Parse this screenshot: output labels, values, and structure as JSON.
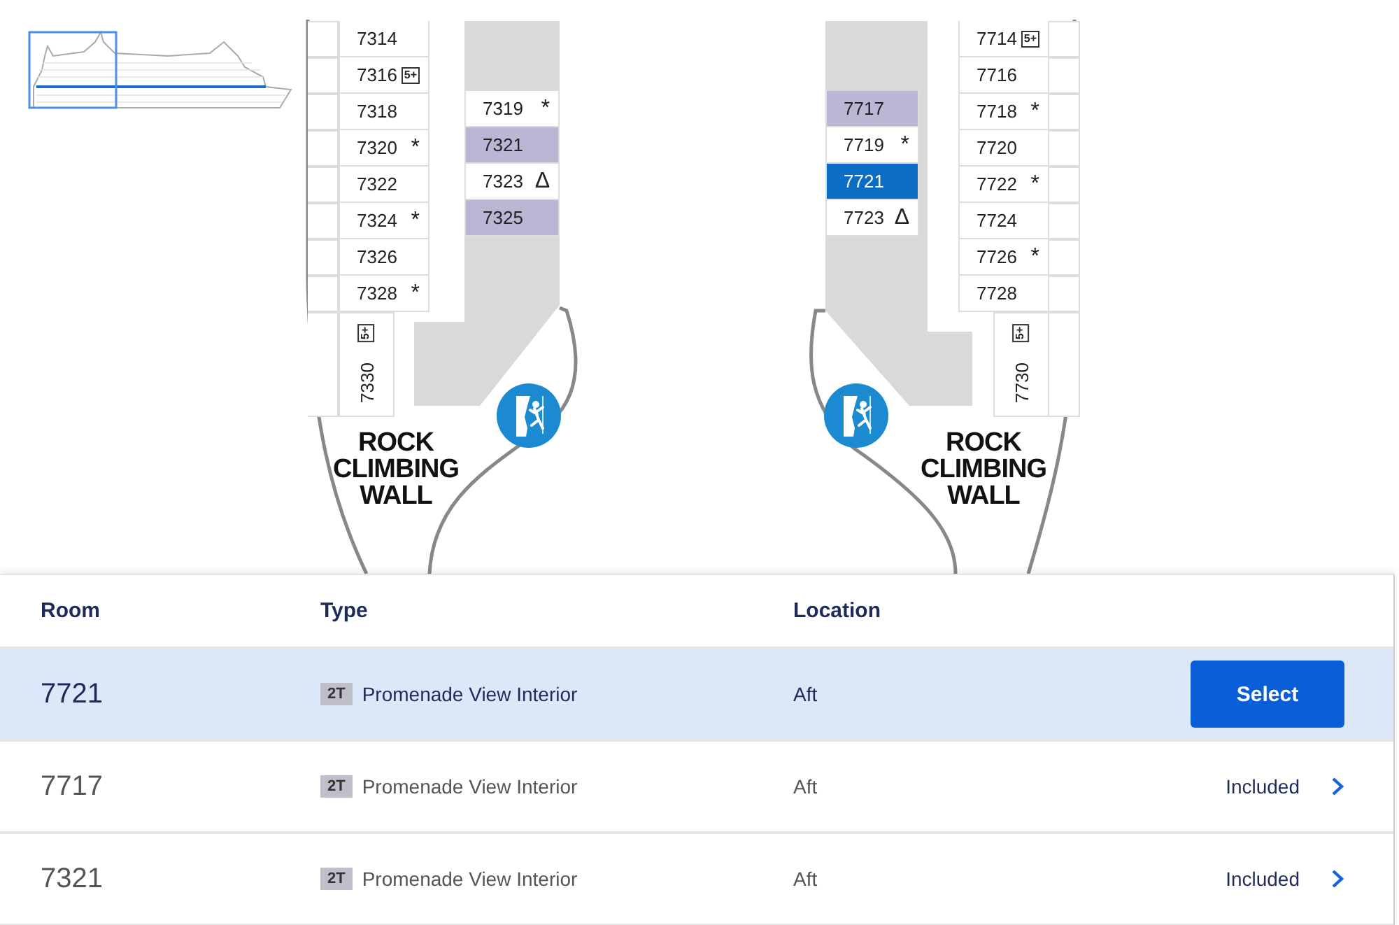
{
  "decks": [
    {
      "outer": [
        {
          "number": "7314",
          "included": false,
          "selected": false
        },
        {
          "number": "7316",
          "included": false,
          "selected": false,
          "badge": "5+"
        },
        {
          "number": "7318",
          "included": false,
          "selected": false
        },
        {
          "number": "7320",
          "included": false,
          "selected": false,
          "mark": "*"
        },
        {
          "number": "7322",
          "included": false,
          "selected": false
        },
        {
          "number": "7324",
          "included": false,
          "selected": false,
          "mark": "*"
        },
        {
          "number": "7326",
          "included": false,
          "selected": false
        },
        {
          "number": "7328",
          "included": false,
          "selected": false,
          "mark": "*"
        }
      ],
      "inner": [
        {
          "number": "7319",
          "included": false,
          "selected": false,
          "mark": "*"
        },
        {
          "number": "7321",
          "included": true,
          "selected": false
        },
        {
          "number": "7323",
          "included": false,
          "selected": false,
          "mark": "Δ"
        },
        {
          "number": "7325",
          "included": true,
          "selected": false
        }
      ],
      "end_cabin": {
        "number": "7330",
        "badge": "5+"
      },
      "venue": "ROCK CLIMBING WALL"
    },
    {
      "outer": [
        {
          "number": "7714",
          "included": false,
          "selected": false,
          "badge": "5+"
        },
        {
          "number": "7716",
          "included": false,
          "selected": false
        },
        {
          "number": "7718",
          "included": false,
          "selected": false,
          "mark": "*"
        },
        {
          "number": "7720",
          "included": false,
          "selected": false
        },
        {
          "number": "7722",
          "included": false,
          "selected": false,
          "mark": "*"
        },
        {
          "number": "7724",
          "included": false,
          "selected": false
        },
        {
          "number": "7726",
          "included": false,
          "selected": false,
          "mark": "*"
        },
        {
          "number": "7728",
          "included": false,
          "selected": false
        }
      ],
      "inner": [
        {
          "number": "7717",
          "included": true,
          "selected": false
        },
        {
          "number": "7719",
          "included": false,
          "selected": false,
          "mark": "*"
        },
        {
          "number": "7721",
          "included": false,
          "selected": true
        },
        {
          "number": "7723",
          "included": false,
          "selected": false,
          "mark": "Δ"
        }
      ],
      "end_cabin": {
        "number": "7730",
        "badge": "5+"
      },
      "venue": "ROCK CLIMBING WALL"
    }
  ],
  "table": {
    "columns": [
      "Room",
      "Type",
      "Location"
    ],
    "rows": [
      {
        "room": "7721",
        "type_code": "2T",
        "type": "Promenade View Interior",
        "location": "Aft",
        "selected": true,
        "action": {
          "kind": "button",
          "label": "Select"
        }
      },
      {
        "room": "7717",
        "type_code": "2T",
        "type": "Promenade View Interior",
        "location": "Aft",
        "selected": false,
        "action": {
          "kind": "link",
          "label": "Included"
        }
      },
      {
        "room": "7321",
        "type_code": "2T",
        "type": "Promenade View Interior",
        "location": "Aft",
        "selected": false,
        "action": {
          "kind": "link",
          "label": "Included"
        }
      }
    ]
  }
}
